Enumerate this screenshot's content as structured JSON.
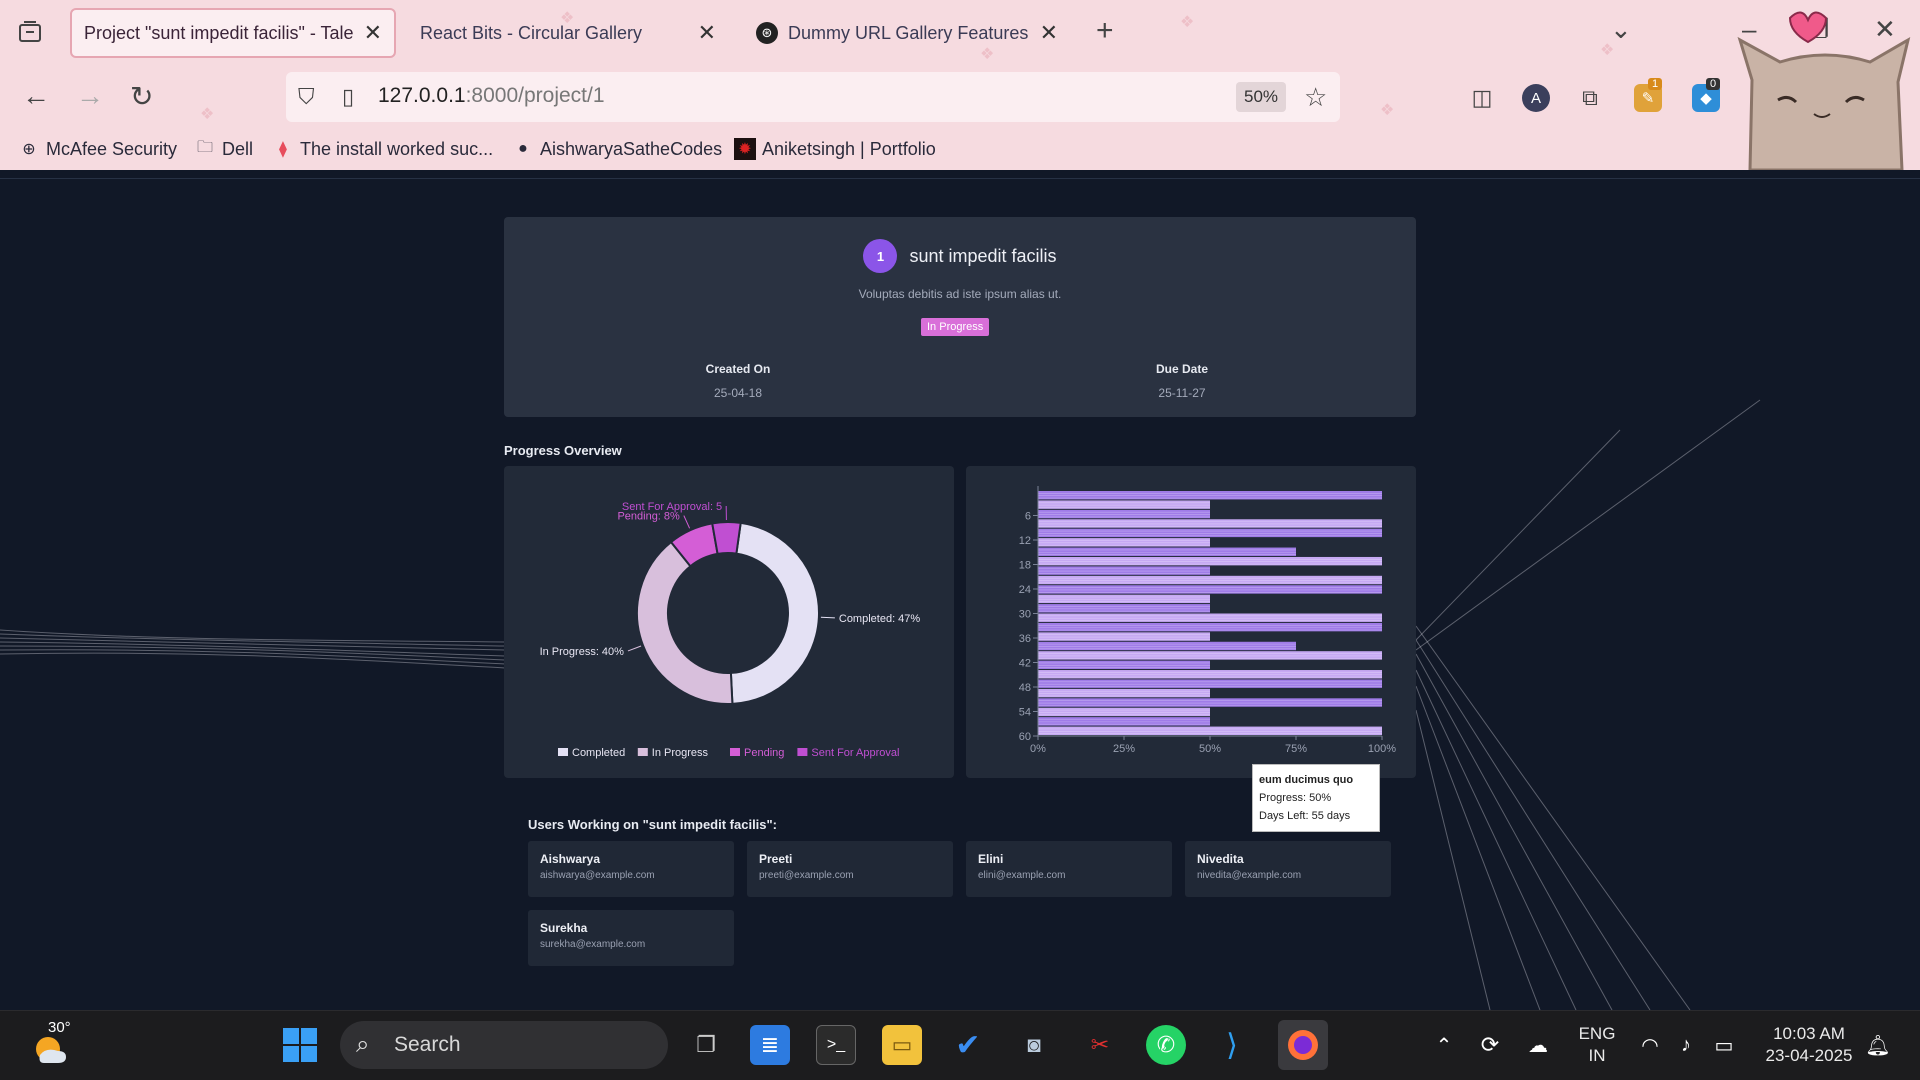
{
  "browser": {
    "tabs": [
      {
        "title": "Project \"sunt impedit facilis\" - Talent",
        "active": true
      },
      {
        "title": "React Bits - Circular Gallery",
        "active": false
      },
      {
        "title": "Dummy URL Gallery Features",
        "active": false
      }
    ],
    "url_host": "127.0.0.1",
    "url_path": ":8000/project/1",
    "zoom": "50%",
    "extension_badges": {
      "ext1": "1",
      "ext2": "0"
    },
    "profile_letter": "A",
    "bookmarks": [
      {
        "label": "McAfee Security"
      },
      {
        "label": "Dell"
      },
      {
        "label": "The install worked suc..."
      },
      {
        "label": "AishwaryaSatheCodes"
      },
      {
        "label": "Aniketsingh | Portfolio"
      }
    ]
  },
  "project": {
    "number": "1",
    "name": "sunt impedit facilis",
    "description": "Voluptas debitis ad iste ipsum alias ut.",
    "status": "In Progress",
    "created_label": "Created On",
    "created_value": "25-04-18",
    "due_label": "Due Date",
    "due_value": "25-11-27"
  },
  "section_title": "Progress Overview",
  "chart_data": [
    {
      "type": "pie",
      "donut": true,
      "labels": [
        "Completed",
        "In Progress",
        "Pending",
        "Sent For Approval"
      ],
      "values": [
        47,
        40,
        8,
        5
      ],
      "slice_labels": [
        "Completed: 47%",
        "In Progress: 40%",
        "Pending: 8%",
        "Sent For Approval: 5"
      ],
      "colors": [
        "#e4e1f4",
        "#d8bfdc",
        "#d45ed6",
        "#c04fd2"
      ],
      "legend": "bottom"
    },
    {
      "type": "bar",
      "orientation": "horizontal",
      "y_ticks": [
        "6",
        "12",
        "18",
        "24",
        "30",
        "36",
        "42",
        "48",
        "54",
        "60"
      ],
      "x_ticks": [
        "0%",
        "25%",
        "50%",
        "75%",
        "100%"
      ],
      "xlim": [
        0,
        100
      ],
      "ylim": [
        0,
        60
      ],
      "grid": false,
      "series": [
        {
          "name": "Progress",
          "color": "#a07ce8",
          "values": [
            100,
            50,
            100,
            75,
            50,
            100,
            50,
            100,
            75,
            50,
            100,
            100,
            50
          ]
        },
        {
          "name": "Days Left",
          "color": "#c6a9f3",
          "values": [
            50,
            100,
            50,
            100,
            100,
            50,
            100,
            50,
            100,
            100,
            50,
            50,
            100
          ]
        }
      ],
      "tooltip": {
        "title": "eum ducimus quo",
        "line1": "Progress: 50%",
        "line2": "Days Left: 55 days"
      }
    }
  ],
  "users_title": "Users Working on \"sunt impedit facilis\":",
  "users": [
    {
      "name": "Aishwarya",
      "email": "aishwarya@example.com"
    },
    {
      "name": "Preeti",
      "email": "preeti@example.com"
    },
    {
      "name": "Elini",
      "email": "elini@example.com"
    },
    {
      "name": "Nivedita",
      "email": "nivedita@example.com"
    },
    {
      "name": "Surekha",
      "email": "surekha@example.com"
    }
  ],
  "taskbar": {
    "temperature": "30°",
    "search_placeholder": "Search",
    "lang_line1": "ENG",
    "lang_line2": "IN",
    "time": "10:03 AM",
    "date": "23-04-2025"
  }
}
